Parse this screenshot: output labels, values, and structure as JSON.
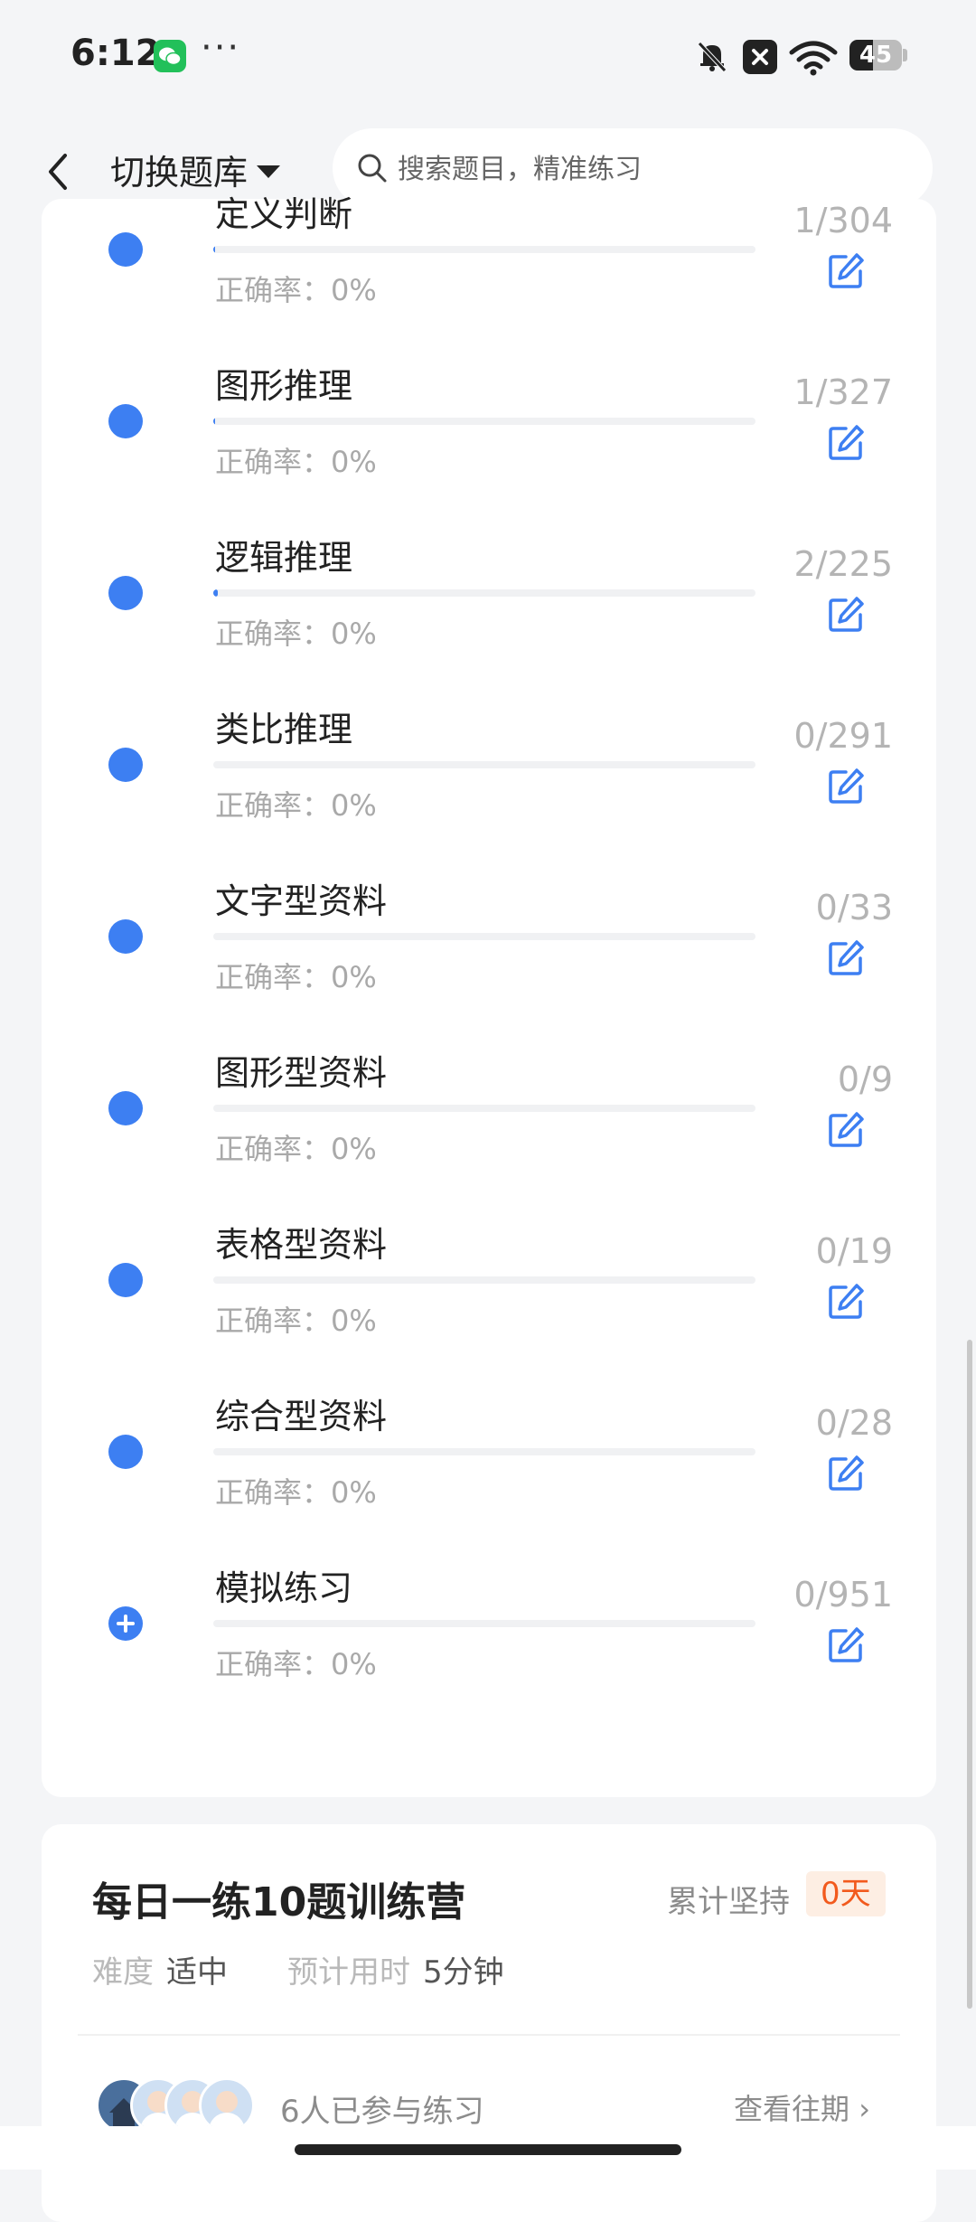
{
  "status": {
    "time": "6:12",
    "more": "···",
    "battery": "45",
    "battery_level_percent": 45,
    "icons": [
      "wechat-icon",
      "bell-off-icon",
      "close-box-icon",
      "wifi-icon",
      "battery-icon"
    ]
  },
  "header": {
    "title": "切换题库",
    "search_placeholder": "搜索题目，精准练习"
  },
  "accent_color": "#3d7ff2",
  "items": [
    {
      "title": "定义判断",
      "accuracy": "正确率：0%",
      "count": "1/304",
      "done": 1,
      "total": 304
    },
    {
      "title": "图形推理",
      "accuracy": "正确率：0%",
      "count": "1/327",
      "done": 1,
      "total": 327
    },
    {
      "title": "逻辑推理",
      "accuracy": "正确率：0%",
      "count": "2/225",
      "done": 2,
      "total": 225
    },
    {
      "title": "类比推理",
      "accuracy": "正确率：0%",
      "count": "0/291",
      "done": 0,
      "total": 291
    },
    {
      "title": "文字型资料",
      "accuracy": "正确率：0%",
      "count": "0/33",
      "done": 0,
      "total": 33
    },
    {
      "title": "图形型资料",
      "accuracy": "正确率：0%",
      "count": "0/9",
      "done": 0,
      "total": 9
    },
    {
      "title": "表格型资料",
      "accuracy": "正确率：0%",
      "count": "0/19",
      "done": 0,
      "total": 19
    },
    {
      "title": "综合型资料",
      "accuracy": "正确率：0%",
      "count": "0/28",
      "done": 0,
      "total": 28
    },
    {
      "title": "模拟练习",
      "accuracy": "正确率：0%",
      "count": "0/951",
      "done": 0,
      "total": 951,
      "expandable": true
    }
  ],
  "camp": {
    "title": "每日一练10题训练营",
    "persist_label": "累计坚持",
    "persist_value": "0天",
    "difficulty_label": "难度",
    "difficulty_value": "适中",
    "time_label": "预计用时",
    "time_value": "5分钟",
    "participants": "6人已参与练习",
    "history_link": "查看往期"
  }
}
